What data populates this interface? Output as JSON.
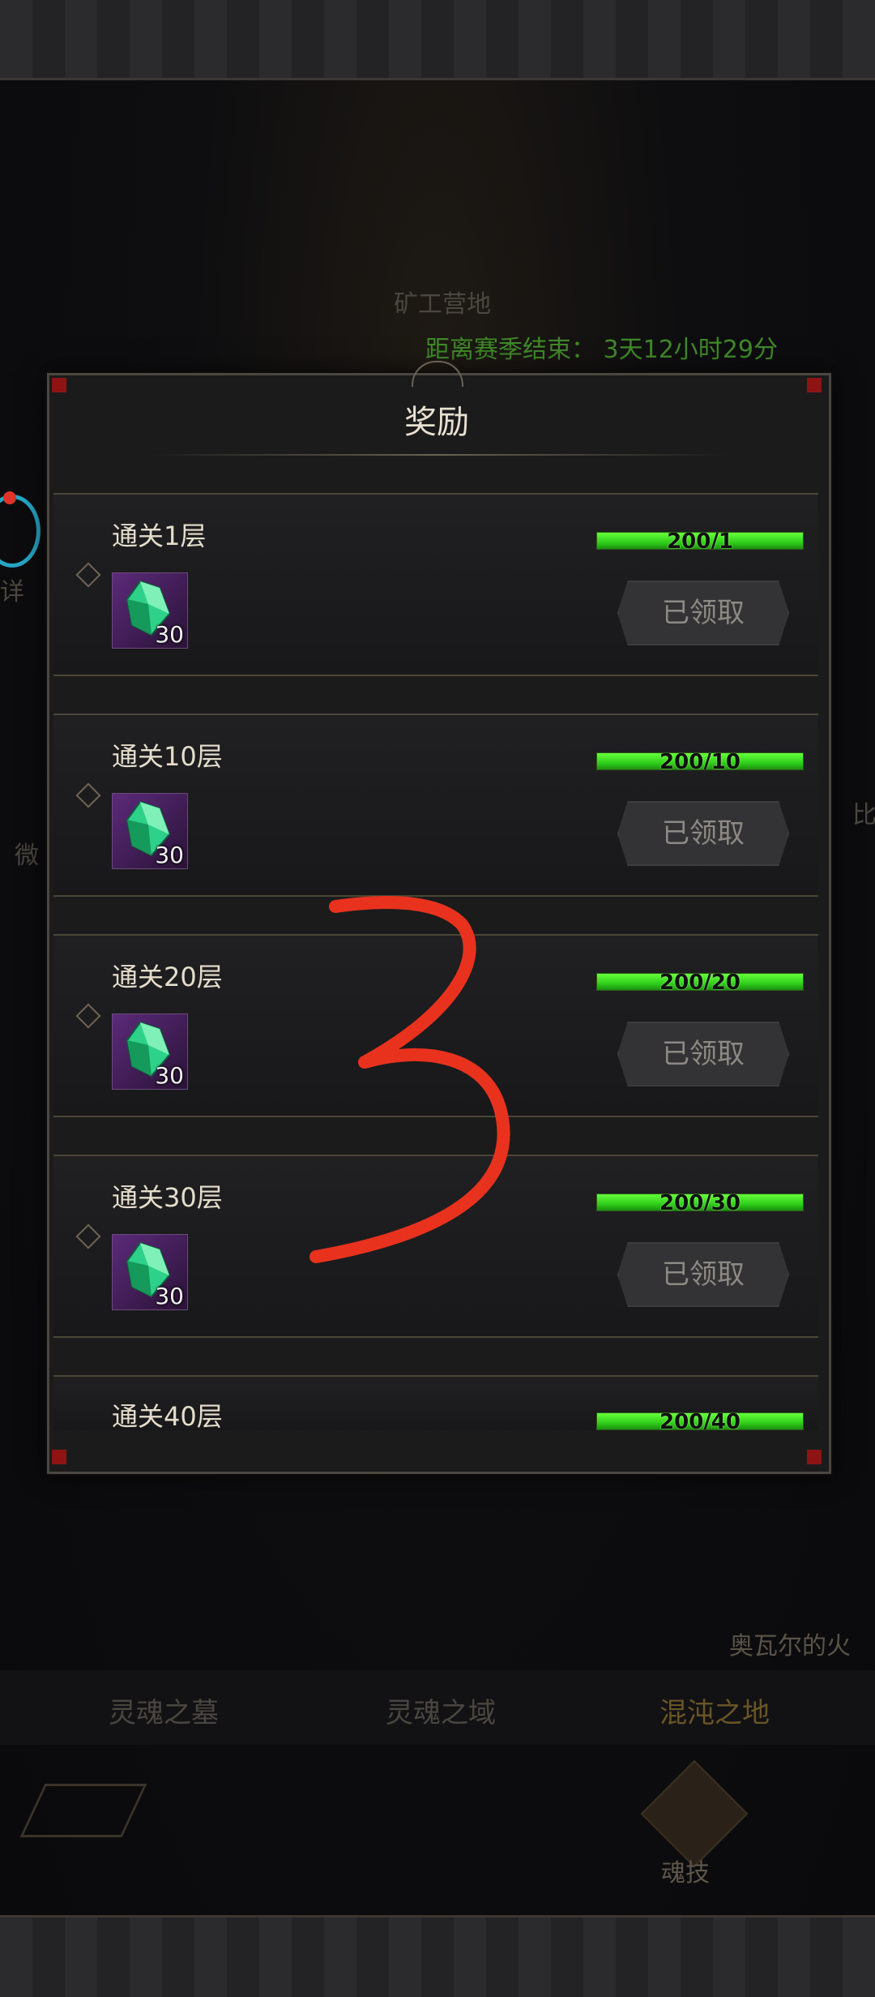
{
  "background": {
    "location_label": "矿工营地",
    "season_countdown": "距离赛季结束： 3天12小时29分",
    "side_label_left": "微",
    "side_label_left2": "详",
    "side_label_right": "比",
    "npc_label": "奥瓦尔的火",
    "tabs": [
      {
        "label": "灵魂之墓"
      },
      {
        "label": "灵魂之域"
      },
      {
        "label": "混沌之地"
      }
    ],
    "soul_skill_label": "魂技"
  },
  "modal": {
    "title": "奖励",
    "rows": [
      {
        "title": "通关1层",
        "item_count": "30",
        "progress_text": "200/1",
        "progress": 1.0,
        "button": "已领取"
      },
      {
        "title": "通关10层",
        "item_count": "30",
        "progress_text": "200/10",
        "progress": 1.0,
        "button": "已领取"
      },
      {
        "title": "通关20层",
        "item_count": "30",
        "progress_text": "200/20",
        "progress": 1.0,
        "button": "已领取"
      },
      {
        "title": "通关30层",
        "item_count": "30",
        "progress_text": "200/30",
        "progress": 1.0,
        "button": "已领取"
      },
      {
        "title": "通关40层",
        "progress_text": "200/40",
        "progress": 1.0
      }
    ]
  },
  "colors": {
    "progress_green": "#3ae01e",
    "corner_red": "#8e1414",
    "annotation_red": "#e8321e"
  }
}
